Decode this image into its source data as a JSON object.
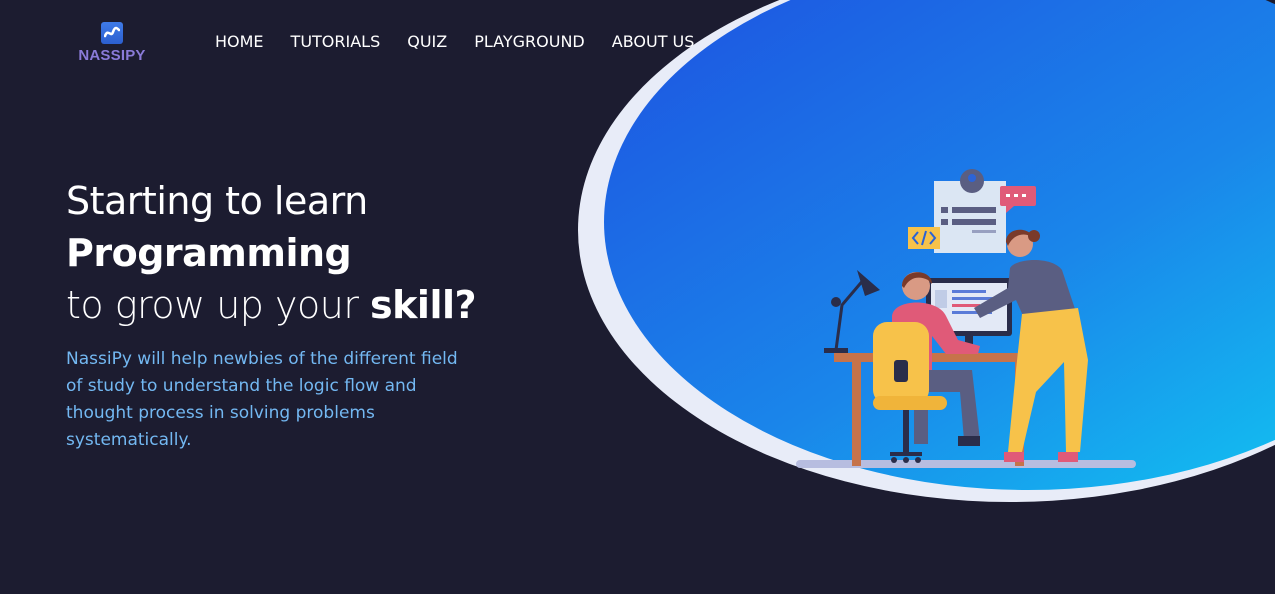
{
  "brand": {
    "name": "NASSIPY"
  },
  "nav": {
    "items": [
      {
        "label": "HOME"
      },
      {
        "label": "TUTORIALS"
      },
      {
        "label": "QUIZ"
      },
      {
        "label": "PLAYGROUND"
      },
      {
        "label": "ABOUT US"
      }
    ]
  },
  "hero": {
    "line1": "Starting to learn",
    "line2": "Programming",
    "line3_prefix": "to grow up your ",
    "line3_emphasis": "skill?",
    "description": "NassiPy will help newbies of the different field of study to understand the logic flow and thought process in solving problems systematically."
  },
  "illustration": {
    "icons": [
      "code-icon",
      "user-icon",
      "chat-icon"
    ],
    "colors": {
      "gradient_start": "#1e56e0",
      "gradient_end": "#14c6f0",
      "background": "#1c1c30"
    }
  }
}
